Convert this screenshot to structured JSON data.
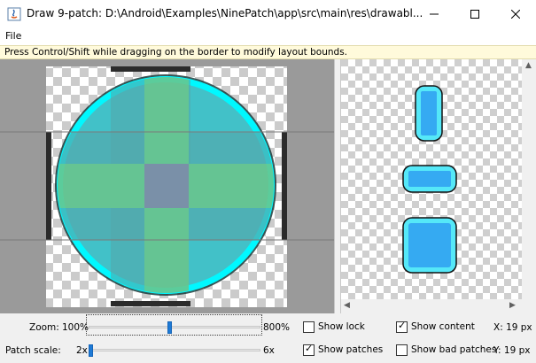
{
  "window": {
    "title": "Draw 9-patch: D:\\Android\\Examples\\NinePatch\\app\\src\\main\\res\\drawabl...",
    "icons": [
      "java-app-icon",
      "minimize-icon",
      "maximize-icon",
      "close-icon"
    ]
  },
  "menu": {
    "file": "File"
  },
  "hint": "Press Control/Shift while dragging on the border to modify layout bounds.",
  "colors": {
    "circle_fill": "#42c1c8",
    "stretch_region": "#6bc48a",
    "center_region": "#7a90a8",
    "preview_fill": "#35aaf2",
    "preview_border": "#55e8f8",
    "edge_cyan": "#00f8ff",
    "slider_thumb": "#1e7ad6"
  },
  "controls": {
    "zoom_label": "Zoom:",
    "zoom_min": "100%",
    "zoom_max": "800%",
    "zoom_fraction": 0.47,
    "patch_scale_label": "Patch scale:",
    "patch_min": "2x",
    "patch_max": "6x",
    "patch_fraction": 0.0,
    "show_lock": {
      "label": "Show lock",
      "checked": false
    },
    "show_patches": {
      "label": "Show patches",
      "checked": true
    },
    "show_content": {
      "label": "Show content",
      "checked": true
    },
    "show_bad_patches": {
      "label": "Show bad patches",
      "checked": false
    },
    "x_readout": "X:  19 px",
    "y_readout": "Y:  19 px"
  }
}
